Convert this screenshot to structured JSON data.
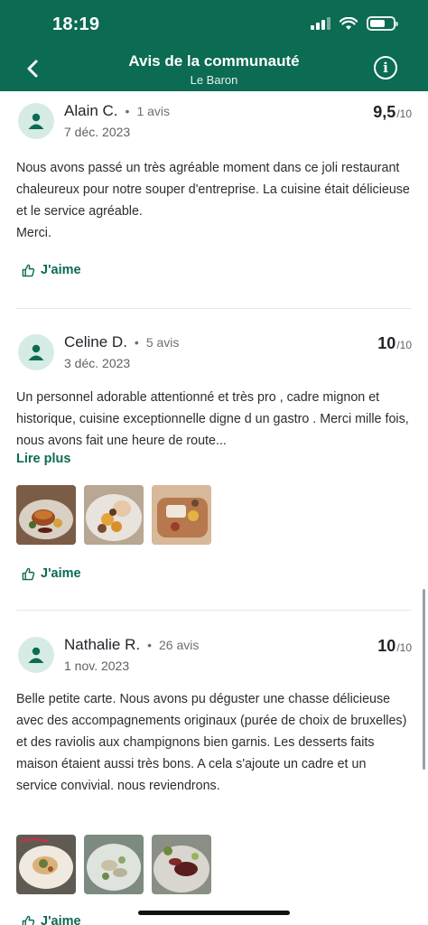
{
  "status_bar": {
    "time": "18:19"
  },
  "nav": {
    "title": "Avis de la communauté",
    "subtitle": "Le Baron",
    "back_icon": "chevron-left-icon",
    "info_icon": "info-icon"
  },
  "colors": {
    "brand": "#0b6b53",
    "avatar_bg": "#d6ebe4"
  },
  "reviews": [
    {
      "name": "Alain C.",
      "count": "1 avis",
      "date": "7 déc. 2023",
      "score": "9,5",
      "score_max": "/10",
      "text": "Nous avons passé un très agréable moment dans ce joli restaurant chaleureux pour notre souper d'entreprise. La cuisine était délicieuse et le service agréable.\nMerci.",
      "like_label": "J'aime"
    },
    {
      "name": "Celine D.",
      "count": "5 avis",
      "date": "3 déc. 2023",
      "score": "10",
      "score_max": "/10",
      "text": "Un personnel adorable attentionné et très pro , cadre mignon et historique, cuisine exceptionnelle digne d un gastro . Merci mille fois, nous avons fait une heure de route...",
      "more_label": "Lire plus",
      "like_label": "J'aime"
    },
    {
      "name": "Nathalie R.",
      "count": "26 avis",
      "date": "1 nov. 2023",
      "score": "10",
      "score_max": "/10",
      "text": "Belle petite carte. Nous avons pu déguster une chasse délicieuse avec des accompagnements originaux (purée de choix de bruxelles) et des raviolis aux champignons bien garnis. Les desserts faits maison étaient aussi très bons. A cela s'ajoute un cadre et un service convivial. nous reviendrons.",
      "like_label": "J'aime"
    }
  ]
}
